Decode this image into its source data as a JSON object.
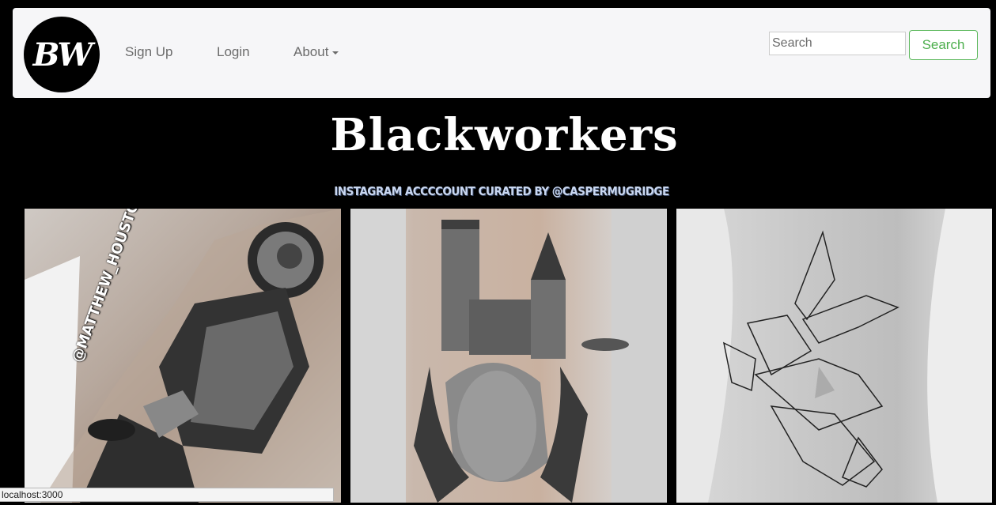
{
  "navbar": {
    "logo_text": "BW",
    "links": [
      {
        "label": "Sign Up"
      },
      {
        "label": "Login"
      },
      {
        "label": "About"
      }
    ],
    "search": {
      "placeholder": "Search",
      "button_label": "Search"
    }
  },
  "hero": {
    "title": "Blackworkers",
    "subtitle": "Instagram accccount curated by @caspermugridge"
  },
  "gallery": {
    "cards": [
      {
        "handle": "@MATTHEW_HOUSTON"
      },
      {
        "handle": ""
      },
      {
        "handle": ""
      }
    ]
  },
  "status_bar": {
    "url": "localhost:3000"
  },
  "colors": {
    "navbar_bg": "#f6f6f8",
    "search_accent": "#5cb85c",
    "page_bg": "#000000"
  }
}
